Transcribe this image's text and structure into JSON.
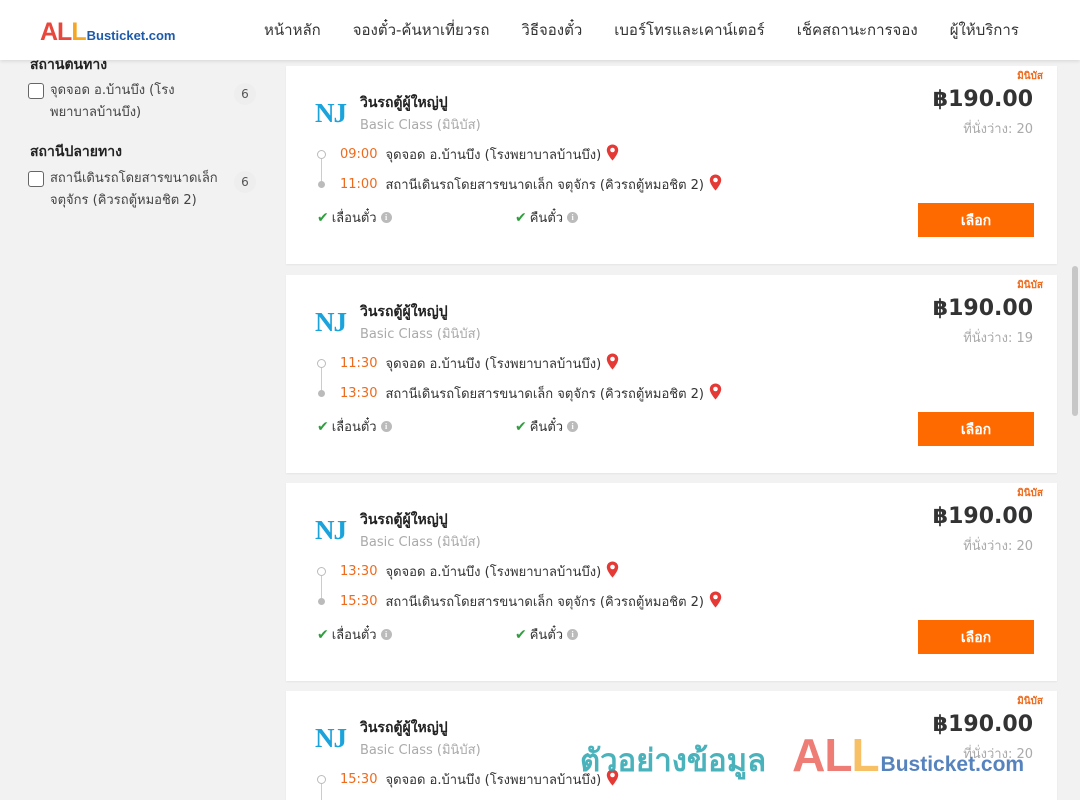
{
  "header": {
    "logo": {
      "all_1": "AL",
      "all_2": "L",
      "bus": "Busticket.com"
    },
    "nav": [
      "หน้าหลัก",
      "จองตั๋ว-ค้นหาเที่ยวรถ",
      "วิธีจองตั๋ว",
      "เบอร์โทรและเคาน์เตอร์",
      "เช็คสถานะการจอง",
      "ผู้ให้บริการ"
    ]
  },
  "sidebar": {
    "origin_title": "สถานีต้นทาง",
    "origin_option": {
      "label": "จุดจอด อ.บ้านบึง (โรงพยาบาลบ้านบึง)",
      "count": "6"
    },
    "destination_title": "สถานีปลายทาง",
    "destination_option": {
      "label": "สถานีเดินรถโดยสารขนาดเล็ก จตุจักร (คิวรถตู้หมอชิต 2)",
      "count": "6"
    }
  },
  "trips": [
    {
      "tag": "มินิบัส",
      "operator_logo": "NJ",
      "operator_name": "วินรถตู้ผู้ใหญ่ปู",
      "class": "Basic Class (มินิบัส)",
      "price": "฿190.00",
      "seats": "ที่นั่งว่าง: 20",
      "depart_time": "09:00",
      "depart_stop": "จุดจอด อ.บ้านบึง (โรงพยาบาลบ้านบึง)",
      "arrive_time": "11:00",
      "arrive_stop": "สถานีเดินรถโดยสารขนาดเล็ก จตุจักร (คิวรถตู้หมอชิต 2)",
      "policy_1": "เลื่อนตั๋ว",
      "policy_2": "คืนตั๋ว",
      "button": "เลือก"
    },
    {
      "tag": "มินิบัส",
      "operator_logo": "NJ",
      "operator_name": "วินรถตู้ผู้ใหญ่ปู",
      "class": "Basic Class (มินิบัส)",
      "price": "฿190.00",
      "seats": "ที่นั่งว่าง: 19",
      "depart_time": "11:30",
      "depart_stop": "จุดจอด อ.บ้านบึง (โรงพยาบาลบ้านบึง)",
      "arrive_time": "13:30",
      "arrive_stop": "สถานีเดินรถโดยสารขนาดเล็ก จตุจักร (คิวรถตู้หมอชิต 2)",
      "policy_1": "เลื่อนตั๋ว",
      "policy_2": "คืนตั๋ว",
      "button": "เลือก"
    },
    {
      "tag": "มินิบัส",
      "operator_logo": "NJ",
      "operator_name": "วินรถตู้ผู้ใหญ่ปู",
      "class": "Basic Class (มินิบัส)",
      "price": "฿190.00",
      "seats": "ที่นั่งว่าง: 20",
      "depart_time": "13:30",
      "depart_stop": "จุดจอด อ.บ้านบึง (โรงพยาบาลบ้านบึง)",
      "arrive_time": "15:30",
      "arrive_stop": "สถานีเดินรถโดยสารขนาดเล็ก จตุจักร (คิวรถตู้หมอชิต 2)",
      "policy_1": "เลื่อนตั๋ว",
      "policy_2": "คืนตั๋ว",
      "button": "เลือก"
    },
    {
      "tag": "มินิบัส",
      "operator_logo": "NJ",
      "operator_name": "วินรถตู้ผู้ใหญ่ปู",
      "class": "Basic Class (มินิบัส)",
      "price": "฿190.00",
      "seats": "ที่นั่งว่าง: 20",
      "depart_time": "15:30",
      "depart_stop": "จุดจอด อ.บ้านบึง (โรงพยาบาลบ้านบึง)",
      "arrive_time": "",
      "arrive_stop": "",
      "policy_1": "",
      "policy_2": "",
      "button": ""
    }
  ],
  "watermark": {
    "text": "ตัวอย่างข้อมูล",
    "all_1": "AL",
    "all_2": "L",
    "bus": "Busticket.com"
  },
  "colors": {
    "accent": "#ff6a00",
    "time": "#ee6a1c",
    "check": "#2e9e3e",
    "operator": "#1ba3dc",
    "pin": "#e53935"
  }
}
